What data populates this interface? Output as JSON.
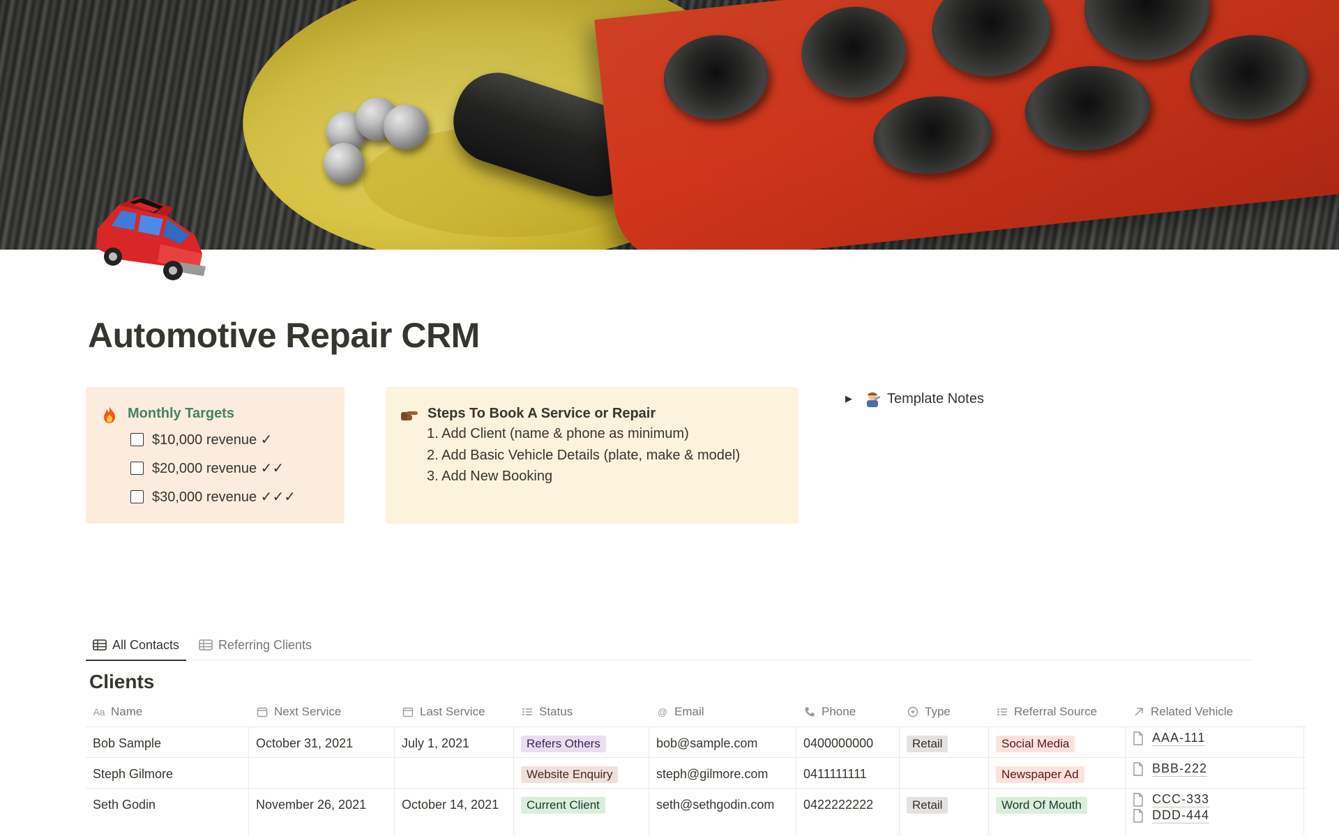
{
  "page": {
    "title": "Automotive Repair CRM"
  },
  "icons": {
    "page_icon": "red-car-icon",
    "targets_emoji": "fire-icon",
    "steps_emoji": "pointing-hand-icon",
    "notes_emoji": "mechanic-icon"
  },
  "monthly_targets": {
    "heading": "Monthly Targets",
    "items": [
      {
        "label": "$10,000 revenue ✓",
        "checked": false
      },
      {
        "label": "$20,000 revenue ✓✓",
        "checked": false
      },
      {
        "label": "$30,000 revenue ✓✓✓",
        "checked": false
      }
    ]
  },
  "steps": {
    "heading": "Steps To Book A Service or Repair",
    "items": [
      "1. Add Client (name & phone as minimum)",
      "2. Add Basic Vehicle Details (plate, make & model)",
      "3. Add New Booking"
    ]
  },
  "template_notes": {
    "label": "Template Notes"
  },
  "views": {
    "tabs": [
      {
        "label": "All Contacts",
        "active": true
      },
      {
        "label": "Referring Clients",
        "active": false
      }
    ]
  },
  "database": {
    "title": "Clients",
    "columns": [
      {
        "label": "Name",
        "icon": "Aa"
      },
      {
        "label": "Next Service",
        "icon": "calendar-icon"
      },
      {
        "label": "Last Service",
        "icon": "calendar-icon"
      },
      {
        "label": "Status",
        "icon": "list-icon"
      },
      {
        "label": "Email",
        "icon": "@"
      },
      {
        "label": "Phone",
        "icon": "phone-icon"
      },
      {
        "label": "Type",
        "icon": "select-icon"
      },
      {
        "label": "Referral Source",
        "icon": "list-icon"
      },
      {
        "label": "Related Vehicle",
        "icon": "arrow-up-right-icon"
      }
    ],
    "rows": [
      {
        "name": "Bob Sample",
        "next_service": "October 31, 2021",
        "last_service": "July 1, 2021",
        "status": "Refers Others",
        "email": "bob@sample.com",
        "phone": "0400000000",
        "type": "Retail",
        "referral_source": "Social Media",
        "vehicles": [
          "AAA-111"
        ]
      },
      {
        "name": "Steph Gilmore",
        "next_service": "",
        "last_service": "",
        "status": "Website Enquiry",
        "email": "steph@gilmore.com",
        "phone": "0411111111",
        "type": "",
        "referral_source": "Newspaper Ad",
        "vehicles": [
          "BBB-222"
        ]
      },
      {
        "name": "Seth Godin",
        "next_service": "November 26, 2021",
        "last_service": "October 14, 2021",
        "status": "Current Client",
        "email": "seth@sethgodin.com",
        "phone": "0422222222",
        "type": "Retail",
        "referral_source": "Word Of Mouth",
        "vehicles": [
          "CCC-333",
          "DDD-444"
        ]
      }
    ]
  },
  "colors": {
    "targets_bg": "#fbecdd",
    "steps_bg": "#fbf3db",
    "targets_heading": "#448361",
    "text": "#37352f",
    "muted": "#787774"
  }
}
